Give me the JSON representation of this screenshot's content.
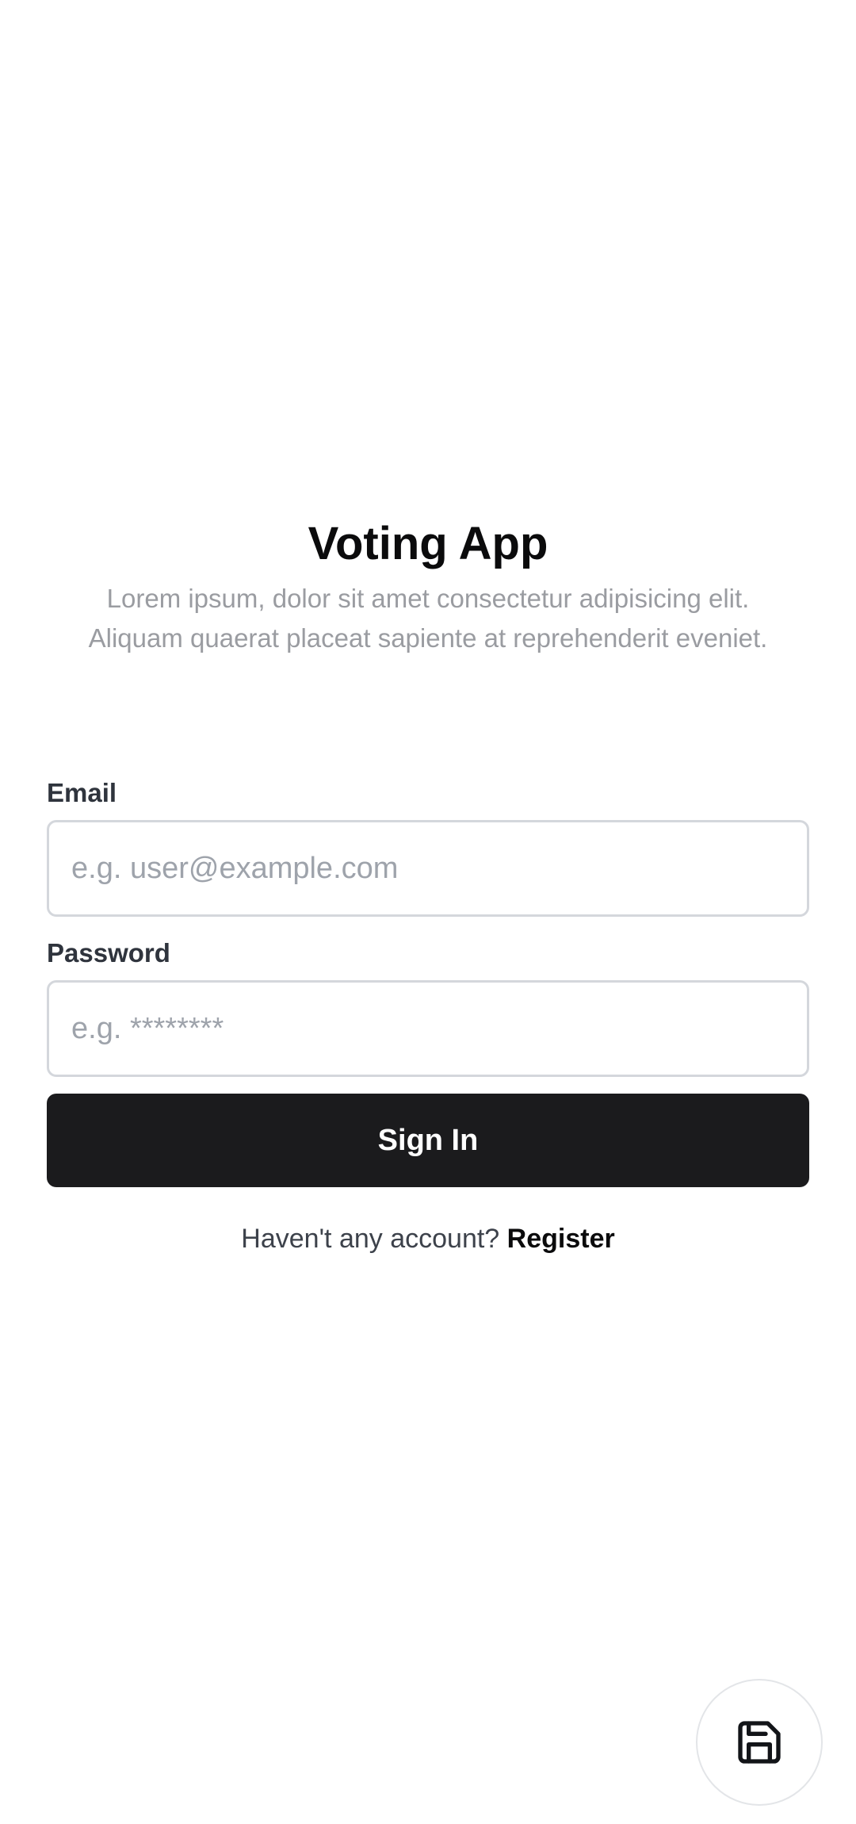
{
  "app": {
    "title": "Voting App",
    "subtitle": "Lorem ipsum, dolor sit amet consectetur adipisicing elit. Aliquam quaerat placeat sapiente at reprehenderit eveniet."
  },
  "form": {
    "email": {
      "label": "Email",
      "value": "",
      "placeholder": "e.g. user@example.com"
    },
    "password": {
      "label": "Password",
      "value": "",
      "placeholder": "e.g. ********"
    },
    "submit_label": "Sign In"
  },
  "register": {
    "prompt": "Haven't any account?",
    "link_label": "Register"
  },
  "fab": {
    "icon": "save-icon"
  },
  "colors": {
    "primary_button": "#1b1b1d",
    "subtitle_text": "#9a9ca1",
    "input_border": "#d4d7dc"
  }
}
